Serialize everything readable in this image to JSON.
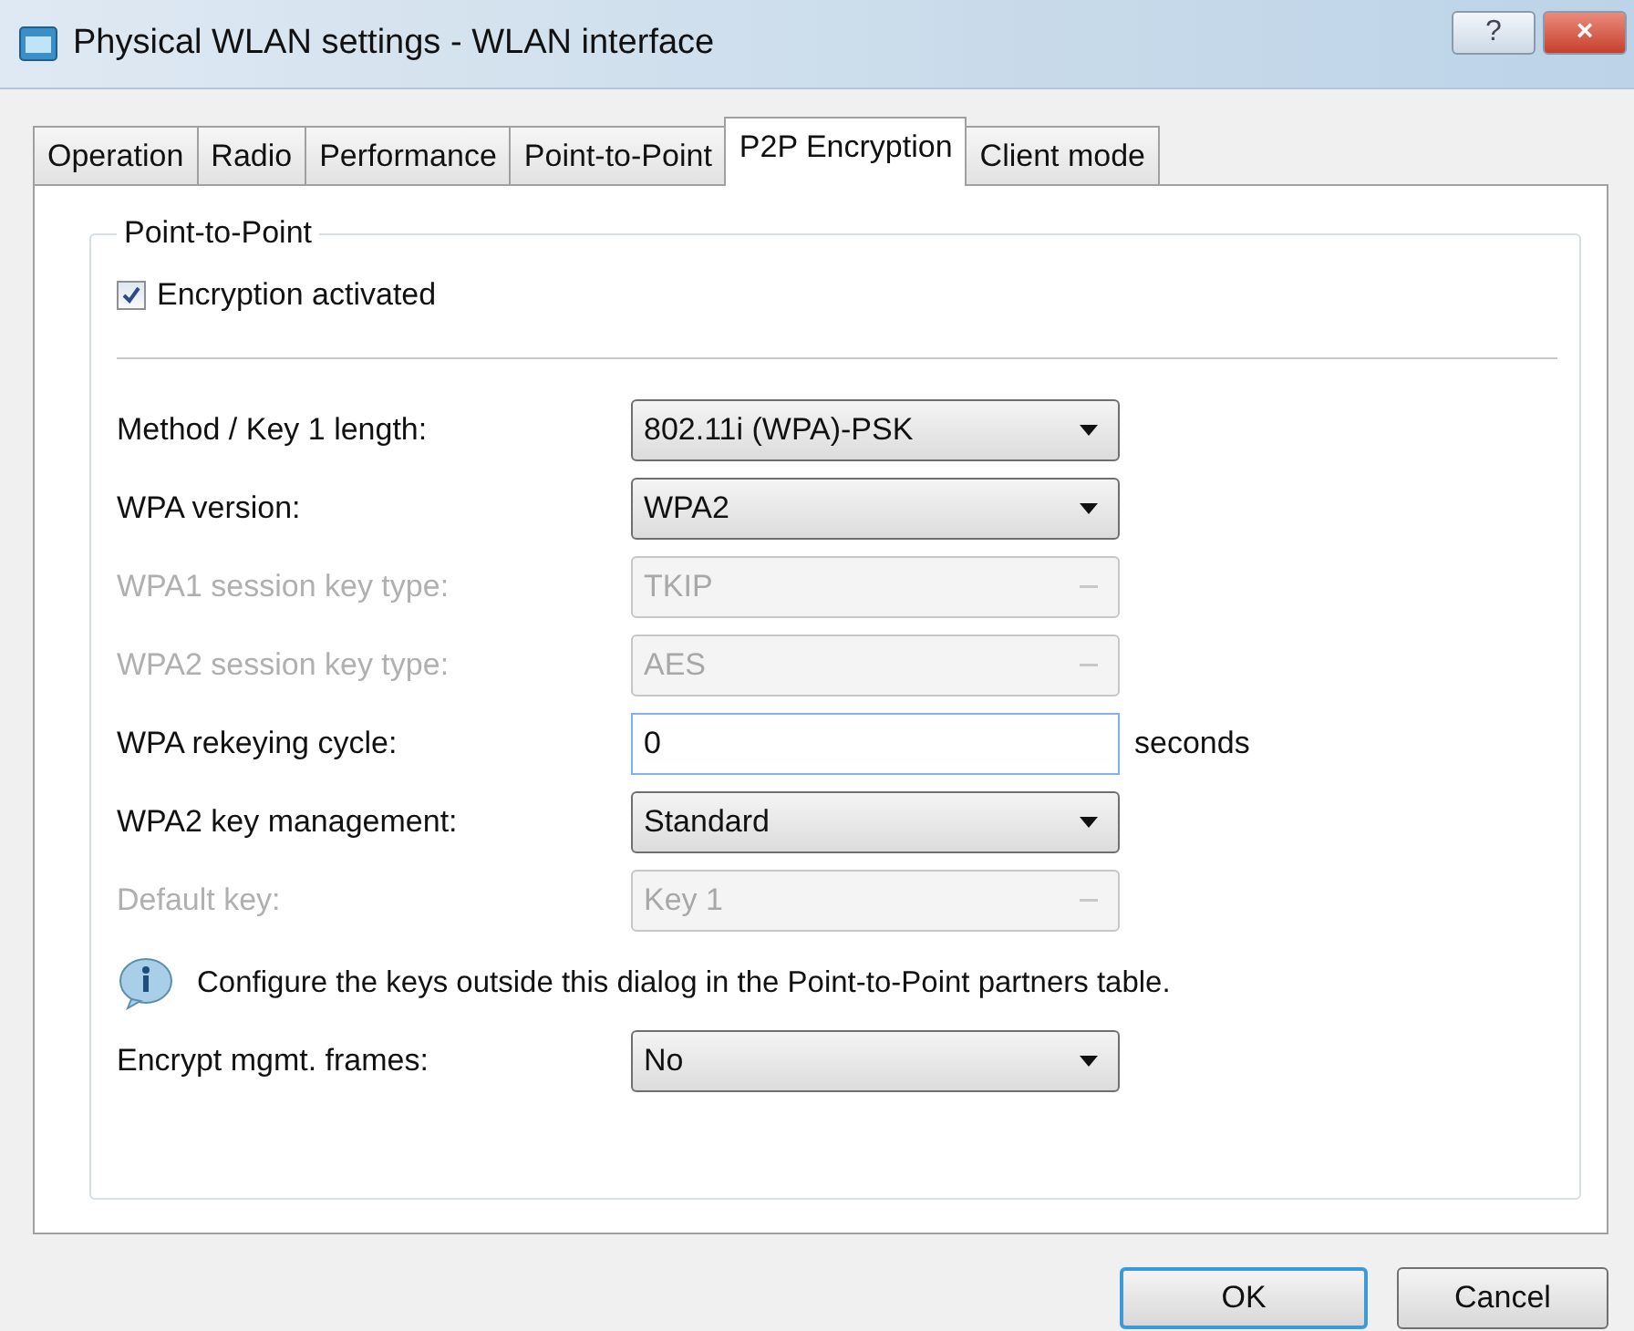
{
  "window": {
    "title": "Physical WLAN settings - WLAN interface",
    "help": "?",
    "close": "×"
  },
  "tabs": [
    {
      "label": "Operation",
      "selected": false
    },
    {
      "label": "Radio",
      "selected": false
    },
    {
      "label": "Performance",
      "selected": false
    },
    {
      "label": "Point-to-Point",
      "selected": false
    },
    {
      "label": "P2P Encryption",
      "selected": true
    },
    {
      "label": "Client mode",
      "selected": false
    }
  ],
  "group": {
    "title": "Point-to-Point",
    "checkbox": {
      "label": "Encryption activated",
      "checked": true
    }
  },
  "rows": [
    {
      "kind": "select",
      "label": "Method / Key 1 length:",
      "value": "802.11i (WPA)-PSK",
      "disabled": false
    },
    {
      "kind": "select",
      "label": "WPA version:",
      "value": "WPA2",
      "disabled": false
    },
    {
      "kind": "select",
      "label": "WPA1 session key type:",
      "value": "TKIP",
      "disabled": true
    },
    {
      "kind": "select",
      "label": "WPA2 session key type:",
      "value": "AES",
      "disabled": true
    },
    {
      "kind": "text",
      "label": "WPA rekeying cycle:",
      "value": "0",
      "unit": "seconds",
      "disabled": false
    },
    {
      "kind": "select",
      "label": "WPA2 key management:",
      "value": "Standard",
      "disabled": false
    },
    {
      "kind": "select",
      "label": "Default key:",
      "value": "Key 1",
      "disabled": true
    },
    {
      "kind": "note",
      "text": "Configure the keys outside this dialog in the Point-to-Point partners table."
    },
    {
      "kind": "select",
      "label": "Encrypt mgmt. frames:",
      "value": "No",
      "disabled": false
    }
  ],
  "buttons": [
    {
      "label": "OK",
      "default": true
    },
    {
      "label": "Cancel",
      "default": false
    }
  ]
}
